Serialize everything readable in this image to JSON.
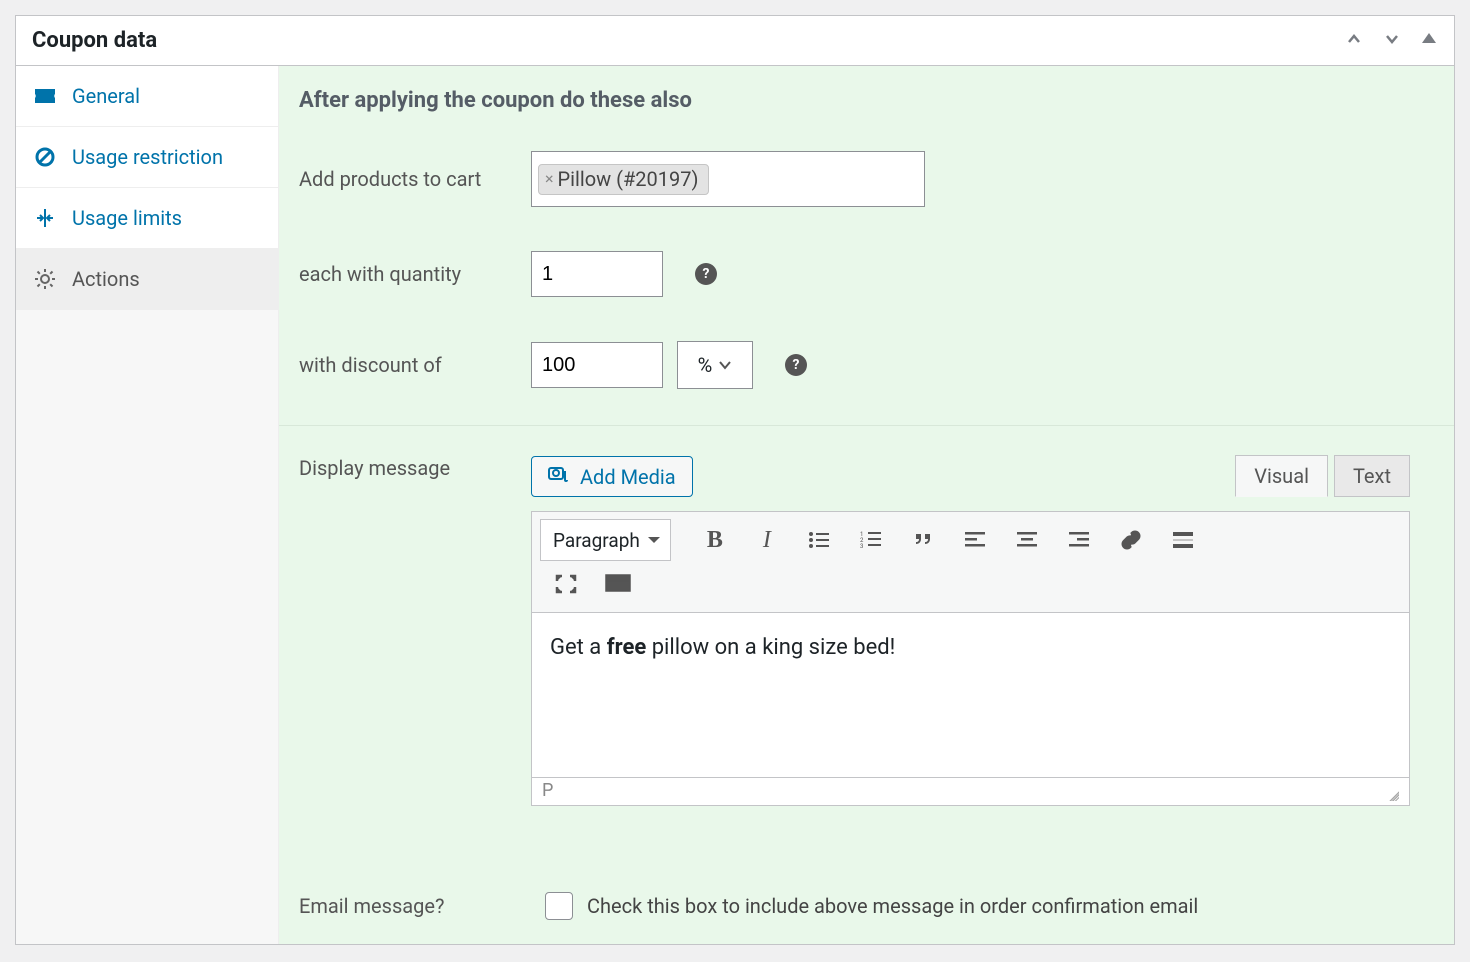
{
  "panel": {
    "title": "Coupon data"
  },
  "sidebar": {
    "items": [
      {
        "label": "General"
      },
      {
        "label": "Usage restriction"
      },
      {
        "label": "Usage limits"
      },
      {
        "label": "Actions"
      }
    ]
  },
  "content": {
    "heading": "After applying the coupon do these also",
    "add_products_label": "Add products to cart",
    "product_tag": "Pillow (#20197)",
    "qty_label": "each with quantity",
    "qty_value": "1",
    "discount_label": "with discount of",
    "discount_value": "100",
    "discount_unit": "%",
    "display_message_label": "Display message",
    "add_media_label": "Add Media",
    "tab_visual": "Visual",
    "tab_text": "Text",
    "format_label": "Paragraph",
    "message_before": "Get a ",
    "message_bold": "free",
    "message_after": " pillow on a king size bed!",
    "status_path": "P",
    "email_label": "Email message?",
    "email_desc": "Check this box to include above message in order confirmation email"
  }
}
